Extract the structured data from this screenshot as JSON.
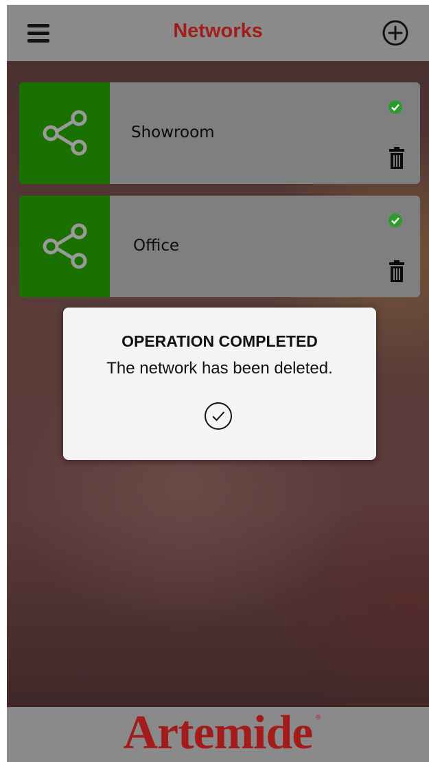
{
  "header": {
    "title": "Networks",
    "menu_icon": "hamburger-menu-icon",
    "add_icon": "plus-circle-icon"
  },
  "networks": [
    {
      "name": "Showroom",
      "icon": "share-icon",
      "status_icon": "green-check-circle-icon",
      "delete_icon": "trash-icon"
    },
    {
      "name": "Office",
      "icon": "share-icon",
      "status_icon": "green-check-circle-icon",
      "delete_icon": "trash-icon"
    }
  ],
  "dialog": {
    "title": "OPERATION COMPLETED",
    "message": "The network has been deleted.",
    "confirm_icon": "check-circle-icon"
  },
  "footer": {
    "brand": "Artemide",
    "brand_mark": "®"
  },
  "colors": {
    "brand_red": "#a31c1c",
    "bar_gray": "#8a8a8a",
    "card_gray": "#7f7f7f",
    "network_green": "#1a7000",
    "status_green": "#2e9a2e"
  }
}
